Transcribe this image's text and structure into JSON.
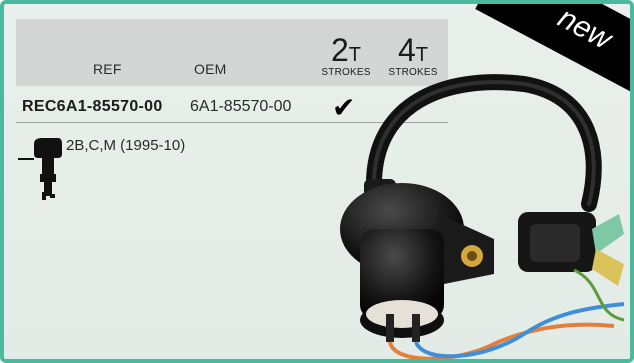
{
  "badge": {
    "label": "new"
  },
  "table": {
    "headers": {
      "ref": "REF",
      "oem": "OEM"
    },
    "strokes": [
      {
        "number": "2",
        "unit": "T",
        "label": "STROKES"
      },
      {
        "number": "4",
        "unit": "T",
        "label": "STROKES"
      }
    ],
    "row": {
      "ref": "REC6A1-85570-00",
      "oem": "6A1-85570-00",
      "two_stroke_check": "✔"
    }
  },
  "compatibility": {
    "models": "2B,C,M (1995-10)",
    "icon": "outboard-motor-icon"
  },
  "product_image": {
    "icon": "ignition-coil-image"
  },
  "colors": {
    "border": "#4bb99d",
    "header": "#d4d6d5",
    "badge": "#000000"
  }
}
